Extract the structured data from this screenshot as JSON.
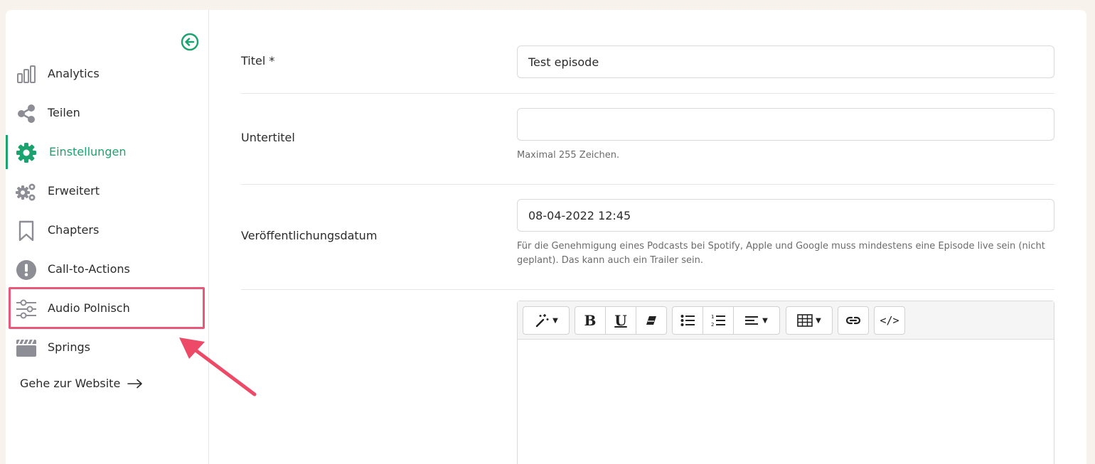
{
  "sidebar": {
    "items": [
      {
        "id": "analytics",
        "label": "Analytics",
        "icon": "bar-chart-icon"
      },
      {
        "id": "teilen",
        "label": "Teilen",
        "icon": "share-icon"
      },
      {
        "id": "einstellungen",
        "label": "Einstellungen",
        "icon": "gear-icon",
        "active": true
      },
      {
        "id": "erweitert",
        "label": "Erweitert",
        "icon": "gears-icon"
      },
      {
        "id": "chapters",
        "label": "Chapters",
        "icon": "bookmark-icon"
      },
      {
        "id": "cta",
        "label": "Call-to-Actions",
        "icon": "exclamation-icon"
      },
      {
        "id": "audio",
        "label": "Audio Polnisch",
        "icon": "sliders-icon",
        "highlighted": true
      },
      {
        "id": "springs",
        "label": "Springs",
        "icon": "clapperboard-icon"
      }
    ],
    "website_link": "Gehe zur Website"
  },
  "form": {
    "title": {
      "label": "Titel *",
      "value": "Test episode"
    },
    "subtitle": {
      "label": "Untertitel",
      "value": "",
      "help": "Maximal 255 Zeichen."
    },
    "publish_date": {
      "label": "Veröffentlichungsdatum",
      "value": "08-04-2022 12:45",
      "help": "Für die Genehmigung eines Podcasts bei Spotify, Apple und Google muss mindestens eine Episode live sein (nicht geplant). Das kann auch ein Trailer sein."
    }
  },
  "editor": {
    "toolbar": {
      "bold": "B",
      "underline": "U",
      "code": "</>"
    }
  },
  "colors": {
    "accent": "#1aa36f",
    "highlight": "#e8587a",
    "background": "#f7f3ec"
  }
}
